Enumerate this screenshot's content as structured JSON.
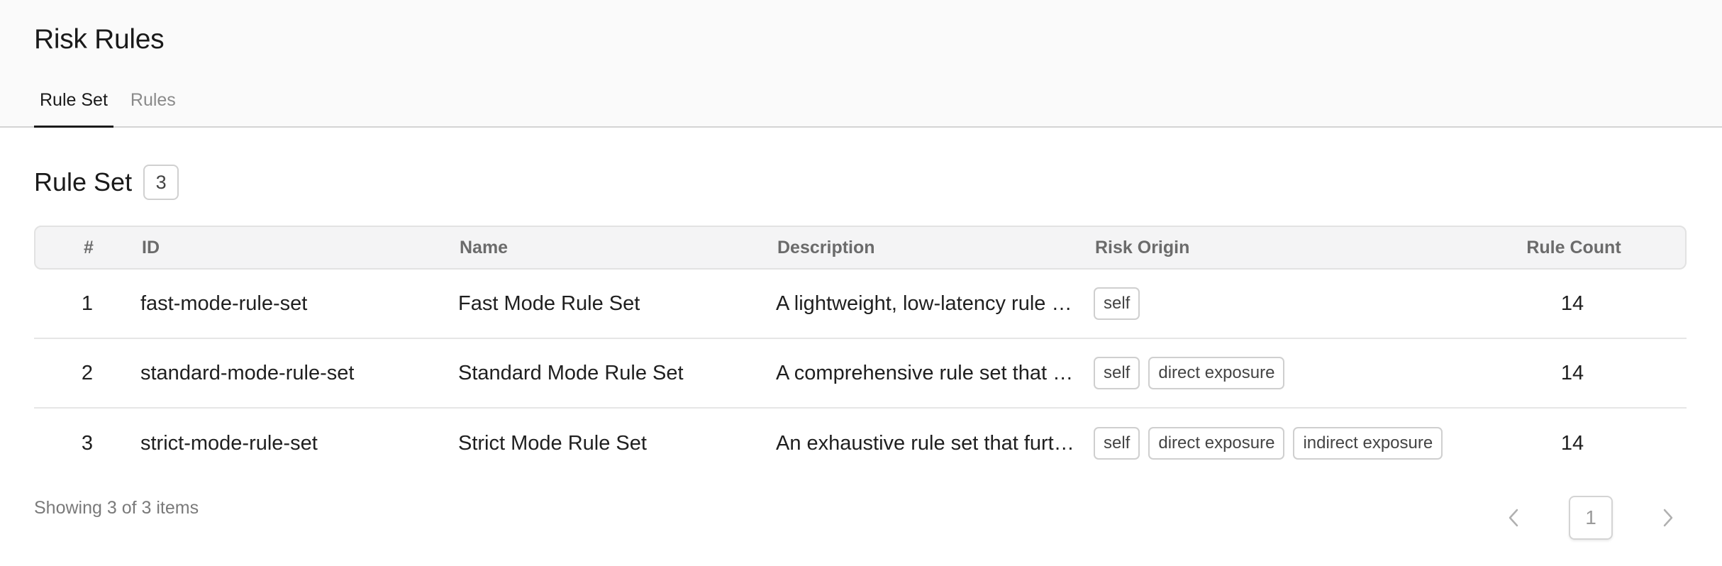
{
  "page": {
    "title": "Risk Rules"
  },
  "tabs": [
    {
      "label": "Rule Set",
      "active": true
    },
    {
      "label": "Rules",
      "active": false
    }
  ],
  "section": {
    "title": "Rule Set",
    "count": "3"
  },
  "table": {
    "headers": {
      "num": "#",
      "id": "ID",
      "name": "Name",
      "description": "Description",
      "risk_origin": "Risk Origin",
      "rule_count": "Rule Count"
    },
    "rows": [
      {
        "num": "1",
        "id": "fast-mode-rule-set",
        "name": "Fast Mode Rule Set",
        "description": "A lightweight, low-latency rule …",
        "risk_origin": [
          "self"
        ],
        "rule_count": "14"
      },
      {
        "num": "2",
        "id": "standard-mode-rule-set",
        "name": "Standard Mode Rule Set",
        "description": "A comprehensive rule set that …",
        "risk_origin": [
          "self",
          "direct exposure"
        ],
        "rule_count": "14"
      },
      {
        "num": "3",
        "id": "strict-mode-rule-set",
        "name": "Strict Mode Rule Set",
        "description": "An exhaustive rule set that furt…",
        "risk_origin": [
          "self",
          "direct exposure",
          "indirect exposure"
        ],
        "rule_count": "14"
      }
    ]
  },
  "footer": {
    "summary": "Showing 3 of 3 items",
    "current_page": "1",
    "prev_icon": "chevron-left-icon",
    "next_icon": "chevron-right-icon"
  },
  "colors": {
    "header_bg": "#fafafa",
    "table_header_bg": "#f4f4f5",
    "active_tab": "#1a1a1a",
    "muted_text": "#8a8a8a"
  }
}
